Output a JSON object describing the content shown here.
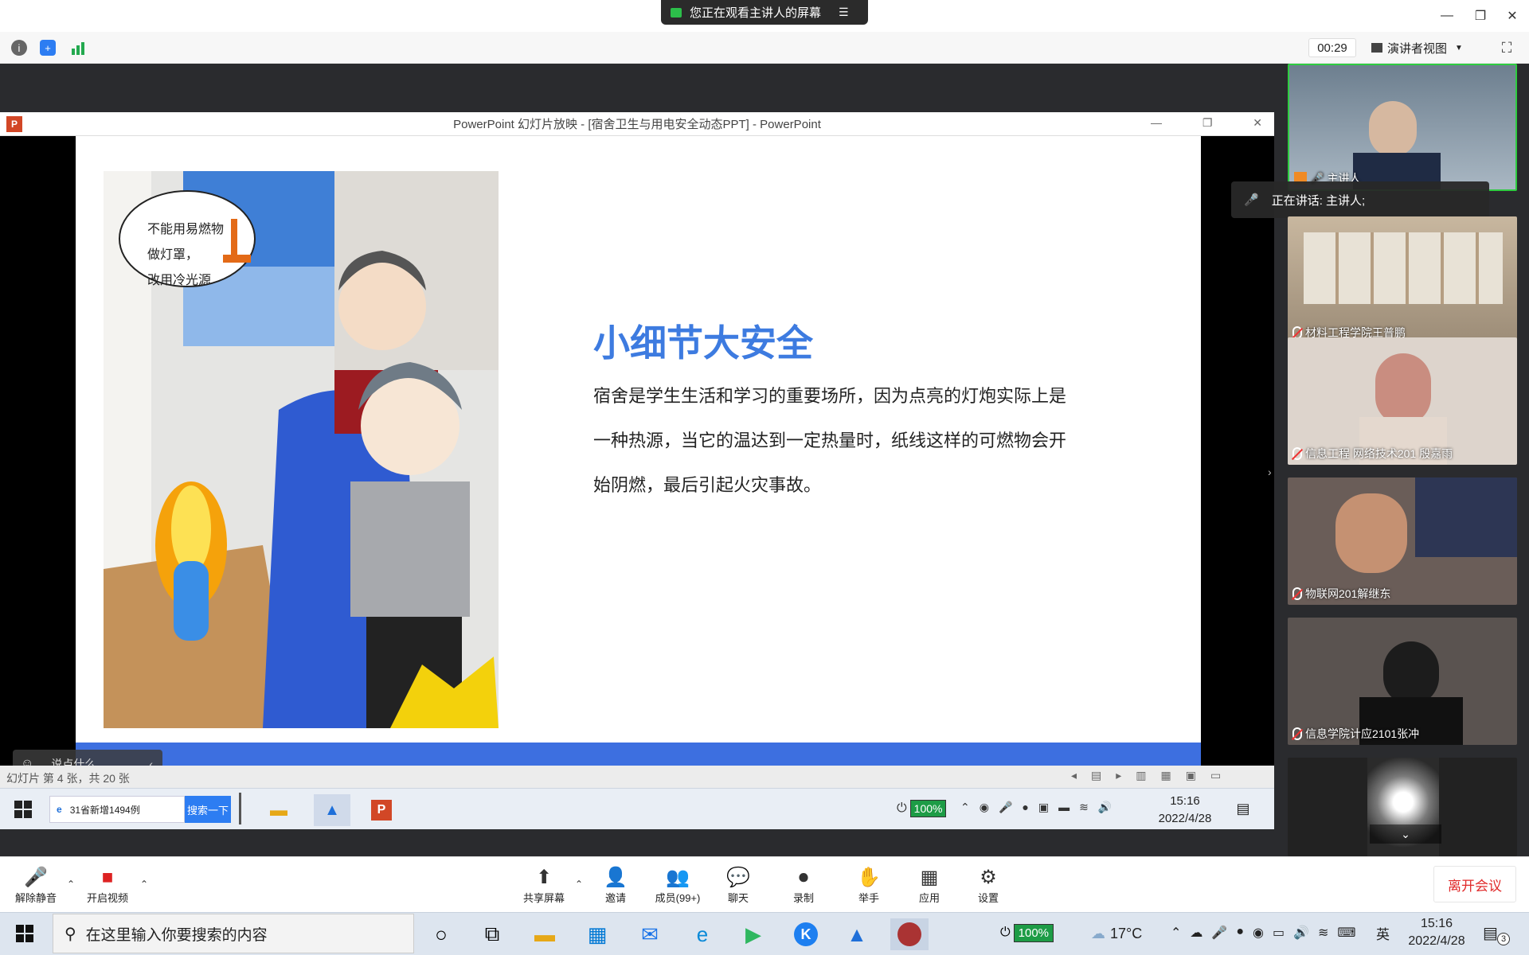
{
  "zoom": {
    "share_banner": "您正在观看主讲人的屏幕",
    "timer": "00:29",
    "view_mode": "演讲者视图",
    "speaking": "正在讲话: 主讲人;",
    "comment_placeholder": "说点什么...",
    "toolbar": {
      "unmute": "解除静音",
      "video": "开启视频",
      "share": "共享屏幕",
      "invite": "邀请",
      "members": "成员(99+)",
      "chat": "聊天",
      "record": "录制",
      "raise_hand": "举手",
      "apps": "应用",
      "settings": "设置",
      "leave": "离开会议"
    },
    "participants": [
      {
        "name": "主讲人"
      },
      {
        "name": "材料工程学院王普鹏"
      },
      {
        "name": "信息工程 网络技术201 殷嘉雨"
      },
      {
        "name": "物联网201解继东"
      },
      {
        "name": "信息学院计应2101张冲"
      }
    ]
  },
  "ppt": {
    "window_title": "PowerPoint 幻灯片放映 - [宿舍卫生与用电安全动态PPT] - PowerPoint",
    "slide_heading": "小细节大安全",
    "slide_body_lines": [
      "宿舍是学生生活和学习的重要场所，因为点亮的灯炮实际上是",
      "一种热源，当它的温达到一定热量时，纸线这样的可燃物会开",
      "始阴燃，最后引起火灾事故。"
    ],
    "speech_bubble": [
      "不能用易燃物",
      "做灯罩，",
      "改用冷光源"
    ],
    "status": "幻灯片 第 4 张，共 20 张"
  },
  "shared_taskbar": {
    "ie_tab": "31省新增1494例",
    "search_btn": "搜索一下",
    "battery": "100%",
    "time": "15:16",
    "date": "2022/4/28"
  },
  "windows_taskbar": {
    "search_placeholder": "在这里输入你要搜索的内容",
    "battery": "100%",
    "weather": "17°C",
    "lang": "英",
    "time": "15:16",
    "date": "2022/4/28",
    "notif_count": "3"
  },
  "colors": {
    "accent_blue": "#3d7be0",
    "slide_bar": "#3d6fe0",
    "leave_red": "#e02a2a"
  }
}
